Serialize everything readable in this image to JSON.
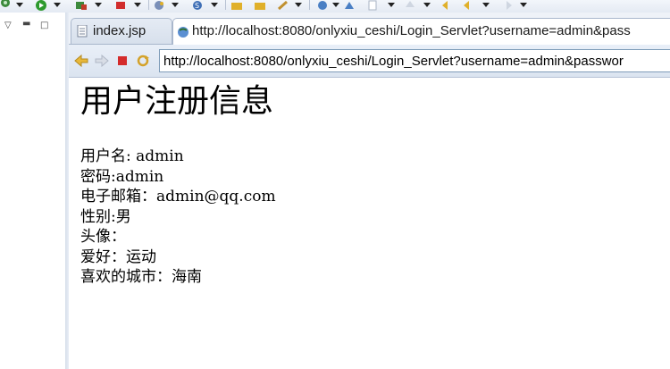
{
  "tabs": {
    "editor_tab_label": "index.jsp",
    "browser_tab_label": "http://localhost:8080/onlyxiu_ceshi/Login_Servlet?username=admin&pass"
  },
  "browser": {
    "url": "http://localhost:8080/onlyxiu_ceshi/Login_Servlet?username=admin&passwor"
  },
  "page": {
    "heading": "用户注册信息",
    "lines": [
      "用户名: admin",
      "密码:admin",
      "电子邮箱：admin@qq.com",
      "性别:男",
      "头像：",
      "爱好：运动",
      "喜欢的城市：海南"
    ]
  },
  "colors": {
    "accent": "#2a5caa",
    "tab_border": "#a9b7cc",
    "toolbar_bg": "#e4eaf3"
  },
  "icons": {
    "toolbar": [
      "debug-icon",
      "run-icon",
      "external-tools-icon",
      "stop-server-icon",
      "new-wizard-icon",
      "web-service-icon",
      "open-folder-icon",
      "open-type-icon",
      "search-icon",
      "globe-icon",
      "next-annotation-icon",
      "previous-annotation-icon",
      "back-icon",
      "forward-icon"
    ],
    "nav": [
      "back-icon",
      "forward-icon",
      "stop-icon",
      "refresh-icon"
    ]
  }
}
